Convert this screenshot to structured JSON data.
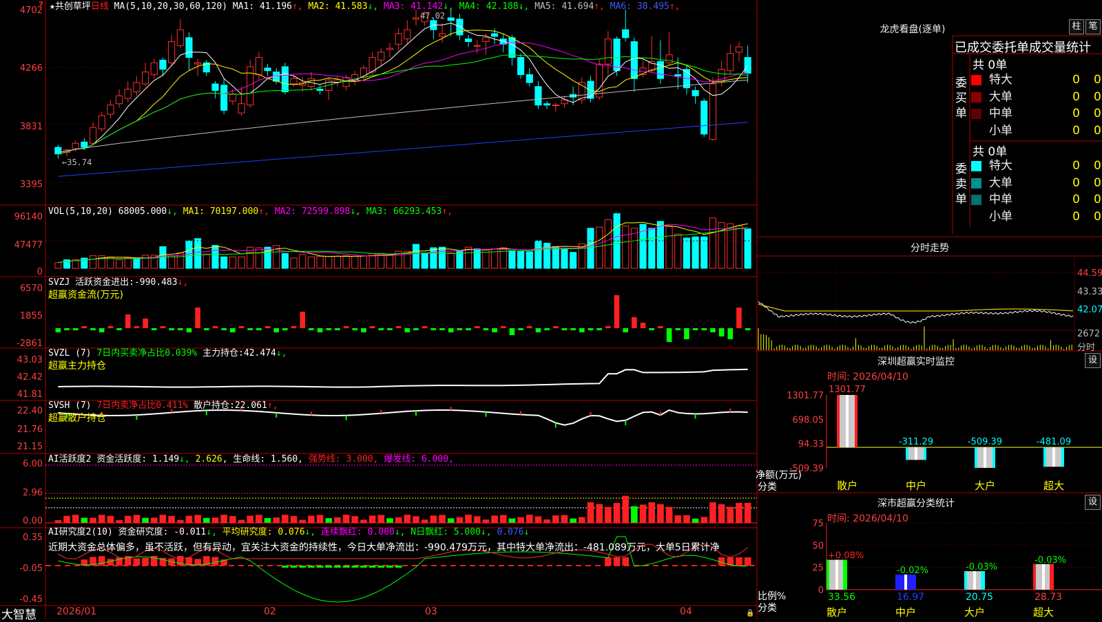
{
  "app": {
    "logo": "大智慧",
    "corner_icon": "question-icon"
  },
  "main": {
    "title": "★共创草坪",
    "period": "日线",
    "ma_text": "MA(5,10,20,30,60,120)",
    "ma_vals": [
      {
        "label": "MA1:",
        "value": "41.196",
        "arrow": "↑",
        "color": "#ffffff"
      },
      {
        "label": "MA2:",
        "value": "41.583",
        "arrow": "↓",
        "color": "#ffff00"
      },
      {
        "label": "MA3:",
        "value": "41.142",
        "arrow": "↓",
        "color": "#ff00ff"
      },
      {
        "label": "MA4:",
        "value": "42.188",
        "arrow": "↓",
        "color": "#00ff00"
      },
      {
        "label": "MA5:",
        "value": "41.694",
        "arrow": "↑",
        "color": "#c0c0c0"
      },
      {
        "label": "MA6:",
        "value": "38.495",
        "arrow": "↑",
        "color": "#3a5cff"
      }
    ],
    "y_ticks": [
      "4702",
      "4266",
      "3831",
      "3395"
    ],
    "high_label": "47.02",
    "low_label": "35.74"
  },
  "vol": {
    "title": "VOL(5,10,20)",
    "vals": [
      {
        "label": "",
        "value": "68005.000",
        "arrow": "↓",
        "color": "#ffffff"
      },
      {
        "label": "MA1:",
        "value": "70197.000",
        "arrow": "↑",
        "color": "#ffff00"
      },
      {
        "label": "MA2:",
        "value": "72599.898",
        "arrow": "↓",
        "color": "#ff00ff"
      },
      {
        "label": "MA3:",
        "value": "66293.453",
        "arrow": "↑",
        "color": "#00ff00"
      }
    ],
    "y_ticks": [
      "96140",
      "47477",
      "0"
    ]
  },
  "svzj": {
    "name": "SVZJ",
    "label": "活跃资金进出:",
    "value": "-990.483",
    "arrow": "↓,",
    "subtitle": "超赢资金流(万元)",
    "y_ticks": [
      "6570",
      "1855",
      "-2861"
    ]
  },
  "svzl": {
    "name": "SVZL (7)",
    "desc": "7日内买卖净占比0.039%",
    "label": "主力持仓:",
    "value": "42.474",
    "arrow": "↓,",
    "subtitle": "超赢主力持仓",
    "y_ticks": [
      "43.03",
      "42.42",
      "41.81"
    ]
  },
  "svsh": {
    "name": "SVSH (7)",
    "desc": "7日内卖净占比0.411%",
    "label": "散户持仓:",
    "value": "22.061",
    "arrow": "↑,",
    "subtitle": "超赢散户持仓",
    "y_ticks": [
      "22.40",
      "21.76",
      "21.15"
    ]
  },
  "ai1": {
    "name": "AI活跃度2",
    "label": "资金活跃度:",
    "v1": "1.149",
    "a1": "↓,",
    "v2": "2.626",
    "a2": ",",
    "label3": "生命线:",
    "v3": "1.560,",
    "strong": "强势线: 3.000,",
    "burst": "爆发线: 6.000,",
    "y_ticks": [
      "6.00",
      "2.96",
      "0.00"
    ]
  },
  "ai2": {
    "name": "AI研究度2(10)",
    "label": "资金研究度:",
    "v1": "-0.011",
    "a1": "↓,",
    "avg": "平均研究度: 0.076",
    "a2": "↓,",
    "cont": "连续飘红: 0.000",
    "a3": "↓,",
    "nday": "N日飘红: 5.000",
    "a4": "↓,",
    "v5": "0.076",
    "a5": "↓",
    "desc": "近期大资金总体偏多，虽不活跃，但有异动，宜关注大资金的持续性，今日大单净流出：-990.479万元，其中特大单净流出：-481.089万元，大单5日累计净",
    "y_ticks": [
      "0.35",
      "-0.05",
      "-0.45"
    ]
  },
  "xaxis": {
    "labels": [
      "2026/01",
      "02",
      "03",
      "04"
    ]
  },
  "orders": {
    "title": "龙虎看盘(逐单)",
    "btn1": "柱",
    "btn2": "笔",
    "tabs": [
      "已成交",
      "委托单",
      "成交量统计"
    ],
    "buy": {
      "vlabel": "委买单",
      "total": "共 0单",
      "rows": [
        {
          "label": "特大",
          "count": "0",
          "pct": "0%",
          "color": "#ff0000"
        },
        {
          "label": "大单",
          "count": "0",
          "pct": "0%",
          "color": "#8b0000"
        },
        {
          "label": "中单",
          "count": "0",
          "pct": "0%",
          "color": "#600000"
        },
        {
          "label": "小单",
          "count": "0",
          "pct": "0%",
          "color": "#000000"
        }
      ]
    },
    "sell": {
      "vlabel": "委卖单",
      "total": "共 0单",
      "rows": [
        {
          "label": "特大",
          "count": "0",
          "pct": "0%",
          "color": "#00ffff"
        },
        {
          "label": "大单",
          "count": "0",
          "pct": "0%",
          "color": "#009090"
        },
        {
          "label": "中单",
          "count": "0",
          "pct": "0%",
          "color": "#007070"
        },
        {
          "label": "小单",
          "count": "0",
          "pct": "0%",
          "color": "#000000"
        }
      ]
    }
  },
  "intraday": {
    "title": "分时走势",
    "y_ticks": [
      "44.59",
      "43.33",
      "42.07"
    ],
    "vol_tick": "2672",
    "vol_label": "分时"
  },
  "monitor": {
    "title": "深圳超赢实时监控",
    "settings": "设",
    "time": "时间: 2026/04/10",
    "y_ticks": [
      "1301.77",
      "698.05",
      "94.33",
      "-509.39"
    ],
    "net_label": "净额(万元)",
    "cat_label": "分类",
    "bars": [
      {
        "cat": "散户",
        "value": 1301.77,
        "label": "1301.77",
        "color": "#ff2020",
        "fill": "#c8c8c8"
      },
      {
        "cat": "中户",
        "value": -311.29,
        "label": "-311.29",
        "color": "#00ffff",
        "fill": "#c8c8c8"
      },
      {
        "cat": "大户",
        "value": -509.39,
        "label": "-509.39",
        "color": "#00ffff",
        "fill": "#c8c8c8"
      },
      {
        "cat": "超大",
        "value": -481.09,
        "label": "-481.09",
        "color": "#00ffff",
        "fill": "#c8c8c8"
      }
    ],
    "ylim": [
      -509.39,
      1301.77
    ]
  },
  "classify": {
    "title": "深市超赢分类统计",
    "settings": "设",
    "time": "时间: 2026/04/10",
    "y_ticks": [
      "75",
      "50",
      "25",
      "0"
    ],
    "ratio_label": "比例%",
    "cat_label": "分类",
    "bars": [
      {
        "cat": "散户",
        "value": 33.56,
        "label": "33.56",
        "change": "+0.08%",
        "change_color": "#ff2020",
        "fill": "#c8c8c8",
        "edge": "#00ff00",
        "cat_color": "#ff0"
      },
      {
        "cat": "中户",
        "value": 16.97,
        "label": "16.97",
        "change": "-0.02%",
        "change_color": "#00ff00",
        "fill": "#2020ff",
        "edge": "#2020ff",
        "cat_color": "#ff0"
      },
      {
        "cat": "大户",
        "value": 20.75,
        "label": "20.75",
        "change": "-0.03%",
        "change_color": "#00ff00",
        "fill": "#c8c8c8",
        "edge": "#00ffff",
        "cat_color": "#ff0"
      },
      {
        "cat": "超大",
        "value": 28.73,
        "label": "28.73",
        "change": "-0.03%",
        "change_color": "#00ff00",
        "fill": "#c8c8c8",
        "edge": "#ff2020",
        "cat_color": "#ff0"
      }
    ],
    "ylim": [
      0,
      75
    ]
  },
  "chart_data": {
    "type": "candlestick",
    "price_ylim": [
      33.95,
      47.02
    ],
    "dates_axis": [
      "2026/01",
      "02",
      "03",
      "04"
    ],
    "candles": [
      [
        36.6,
        36.1,
        36.8,
        35.74
      ],
      [
        36.2,
        36.4,
        36.5,
        35.9
      ],
      [
        36.5,
        36.9,
        37.1,
        36.3
      ],
      [
        37.0,
        36.6,
        37.3,
        36.4
      ],
      [
        36.9,
        38.1,
        38.5,
        36.7
      ],
      [
        38.0,
        39.0,
        39.3,
        37.8
      ],
      [
        39.1,
        39.8,
        40.2,
        38.8
      ],
      [
        39.9,
        40.5,
        41.0,
        39.6
      ],
      [
        40.3,
        41.0,
        41.6,
        40.0
      ],
      [
        40.8,
        41.5,
        42.0,
        40.5
      ],
      [
        41.4,
        42.3,
        43.0,
        41.2
      ],
      [
        42.1,
        43.0,
        43.3,
        41.8
      ],
      [
        43.2,
        42.5,
        43.4,
        42.0
      ],
      [
        43.0,
        44.6,
        45.1,
        42.8
      ],
      [
        44.3,
        45.5,
        46.3,
        44.1
      ],
      [
        44.9,
        43.4,
        45.3,
        42.4
      ],
      [
        42.9,
        43.0,
        43.3,
        42.0
      ],
      [
        43.0,
        42.3,
        43.2,
        42.0
      ],
      [
        41.4,
        40.9,
        41.6,
        40.3
      ],
      [
        41.3,
        39.4,
        41.8,
        39.1
      ],
      [
        40.1,
        40.6,
        41.0,
        39.8
      ],
      [
        39.2,
        39.9,
        41.2,
        39.0
      ],
      [
        39.8,
        42.7,
        43.2,
        39.6
      ],
      [
        42.1,
        43.4,
        43.8,
        41.7
      ],
      [
        42.6,
        42.4,
        42.9,
        42.0
      ],
      [
        42.3,
        41.6,
        42.6,
        41.4
      ],
      [
        42.7,
        40.8,
        43.0,
        40.6
      ],
      [
        41.4,
        41.8,
        42.0,
        41.2
      ],
      [
        41.3,
        41.5,
        41.9,
        40.8
      ],
      [
        41.2,
        41.8,
        42.3,
        40.9
      ],
      [
        41.0,
        40.9,
        41.3,
        40.6
      ],
      [
        40.9,
        41.7,
        41.9,
        40.2
      ],
      [
        41.5,
        41.7,
        42.0,
        41.2
      ],
      [
        41.2,
        41.9,
        42.1,
        40.9
      ],
      [
        41.7,
        42.1,
        42.4,
        41.3
      ],
      [
        41.9,
        42.6,
        42.8,
        41.6
      ],
      [
        42.3,
        43.4,
        43.8,
        42.1
      ],
      [
        43.2,
        43.8,
        44.1,
        42.8
      ],
      [
        44.0,
        44.1,
        44.5,
        43.4
      ],
      [
        44.4,
        45.2,
        45.6,
        43.9
      ],
      [
        44.8,
        45.5,
        46.2,
        44.4
      ],
      [
        46.3,
        46.4,
        47.02,
        45.8
      ],
      [
        46.1,
        46.7,
        46.9,
        45.8
      ],
      [
        46.2,
        45.5,
        46.4,
        44.8
      ],
      [
        45.0,
        45.2,
        46.0,
        44.5
      ],
      [
        46.4,
        46.2,
        47.0,
        45.0
      ],
      [
        46.3,
        45.1,
        46.7,
        44.7
      ],
      [
        44.8,
        44.6,
        45.1,
        44.2
      ],
      [
        44.3,
        44.3,
        44.7,
        43.7
      ],
      [
        44.6,
        44.9,
        45.2,
        43.6
      ],
      [
        45.2,
        45.0,
        45.6,
        44.4
      ],
      [
        44.8,
        44.4,
        45.2,
        43.8
      ],
      [
        44.9,
        43.4,
        45.1,
        42.8
      ],
      [
        43.4,
        42.1,
        43.7,
        41.8
      ],
      [
        42.1,
        41.5,
        42.6,
        41.2
      ],
      [
        41.2,
        39.8,
        41.6,
        39.5
      ],
      [
        39.9,
        39.8,
        40.1,
        39.5
      ],
      [
        39.8,
        39.8,
        40.0,
        39.3
      ],
      [
        39.9,
        40.2,
        40.5,
        39.6
      ],
      [
        40.6,
        40.4,
        41.2,
        39.8
      ],
      [
        40.2,
        41.5,
        41.9,
        39.9
      ],
      [
        41.6,
        40.3,
        42.0,
        40.0
      ],
      [
        40.4,
        42.9,
        43.3,
        40.2
      ],
      [
        42.9,
        44.8,
        45.4,
        42.1
      ],
      [
        44.8,
        42.4,
        45.0,
        42.0
      ],
      [
        45.5,
        44.9,
        47.0,
        44.6
      ],
      [
        44.6,
        41.8,
        44.9,
        40.8
      ],
      [
        42.1,
        42.6,
        43.2,
        41.9
      ],
      [
        42.4,
        43.1,
        45.0,
        42.2
      ],
      [
        43.1,
        41.8,
        44.7,
        41.4
      ],
      [
        43.0,
        43.6,
        45.3,
        42.8
      ],
      [
        42.1,
        42.0,
        43.4,
        41.0
      ],
      [
        42.5,
        41.1,
        42.8,
        40.6
      ],
      [
        40.9,
        40.5,
        41.2,
        39.9
      ],
      [
        40.1,
        37.6,
        40.3,
        37.4
      ],
      [
        37.2,
        41.4,
        41.9,
        37.1
      ],
      [
        41.6,
        42.5,
        43.1,
        41.2
      ],
      [
        42.4,
        43.7,
        44.4,
        42.1
      ],
      [
        43.8,
        44.2,
        44.6,
        43.1
      ],
      [
        43.4,
        42.2,
        44.3,
        41.5
      ]
    ],
    "volumes_k": [
      [
        10,
        1
      ],
      [
        15,
        0
      ],
      [
        15,
        1
      ],
      [
        18,
        0
      ],
      [
        22,
        1
      ],
      [
        22,
        1
      ],
      [
        20,
        1
      ],
      [
        15,
        1
      ],
      [
        18,
        1
      ],
      [
        17,
        0
      ],
      [
        23,
        1
      ],
      [
        23,
        1
      ],
      [
        38,
        0
      ],
      [
        22,
        1
      ],
      [
        27,
        1
      ],
      [
        48,
        0
      ],
      [
        52,
        0
      ],
      [
        25,
        1
      ],
      [
        40,
        0
      ],
      [
        20,
        0
      ],
      [
        20,
        1
      ],
      [
        20,
        1
      ],
      [
        37,
        1
      ],
      [
        36,
        1
      ],
      [
        37,
        0
      ],
      [
        40,
        1
      ],
      [
        26,
        0
      ],
      [
        18,
        1
      ],
      [
        24,
        1
      ],
      [
        20,
        1
      ],
      [
        21,
        1
      ],
      [
        21,
        1
      ],
      [
        21,
        1
      ],
      [
        22,
        1
      ],
      [
        21,
        1
      ],
      [
        22,
        1
      ],
      [
        26,
        1
      ],
      [
        26,
        1
      ],
      [
        23,
        1
      ],
      [
        30,
        1
      ],
      [
        30,
        1
      ],
      [
        42,
        0
      ],
      [
        26,
        0
      ],
      [
        36,
        0
      ],
      [
        37,
        0
      ],
      [
        27,
        1
      ],
      [
        30,
        0
      ],
      [
        37,
        1
      ],
      [
        34,
        0
      ],
      [
        33,
        1
      ],
      [
        34,
        1
      ],
      [
        36,
        1
      ],
      [
        31,
        0
      ],
      [
        30,
        0
      ],
      [
        29,
        0
      ],
      [
        48,
        0
      ],
      [
        44,
        0
      ],
      [
        38,
        0
      ],
      [
        33,
        0
      ],
      [
        28,
        0
      ],
      [
        43,
        1
      ],
      [
        70,
        0
      ],
      [
        72,
        1
      ],
      [
        85,
        1
      ],
      [
        96,
        0
      ],
      [
        74,
        1
      ],
      [
        70,
        1
      ],
      [
        77,
        0
      ],
      [
        70,
        0
      ],
      [
        82,
        0
      ],
      [
        73,
        1
      ],
      [
        60,
        1
      ],
      [
        53,
        0
      ],
      [
        55,
        0
      ],
      [
        55,
        0
      ],
      [
        88,
        1
      ],
      [
        80,
        1
      ],
      [
        78,
        1
      ],
      [
        74,
        1
      ],
      [
        69,
        0
      ]
    ]
  }
}
